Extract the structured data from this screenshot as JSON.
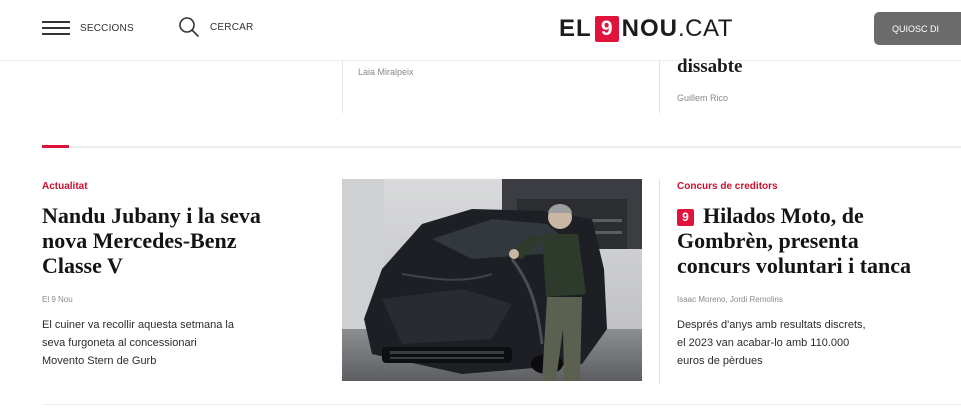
{
  "header": {
    "menu_label": "SECCIONS",
    "search_label": "CERCAR",
    "logo": {
      "el": "EL",
      "nine": "9",
      "nou": "NOU",
      "cat": ".CAT"
    },
    "kiosk_label": "QUIOSC DI",
    "brand_color": "#e0133c"
  },
  "previous_row": {
    "byline_middle": "Laia Miralpeix",
    "title_right": "dissabte",
    "byline_right": "Guillem Rico"
  },
  "articles": [
    {
      "kicker": "Actualitat",
      "headline_lines": [
        "Nandu Jubany i la seva",
        "nova Mercedes-Benz",
        "Classe V"
      ],
      "byline": "El 9 Nou",
      "summary_lines": [
        "El cuiner va recollir aquesta setmana la",
        "seva furgoneta al concessionari",
        "Movento Stern de Gurb"
      ]
    },
    {
      "kicker": "Concurs de creditors",
      "badge_icon": "el9nou-badge-icon",
      "headline_lines": [
        "Hilados Moto, de",
        "Gombrèn, presenta",
        "concurs voluntari i tanca"
      ],
      "byline": "Isaac Moreno, Jordi Remolins",
      "summary_lines": [
        "Després d'anys amb resultats discrets,",
        "el 2023 van acabar-lo amb 110.000",
        "euros de pèrdues"
      ]
    }
  ]
}
